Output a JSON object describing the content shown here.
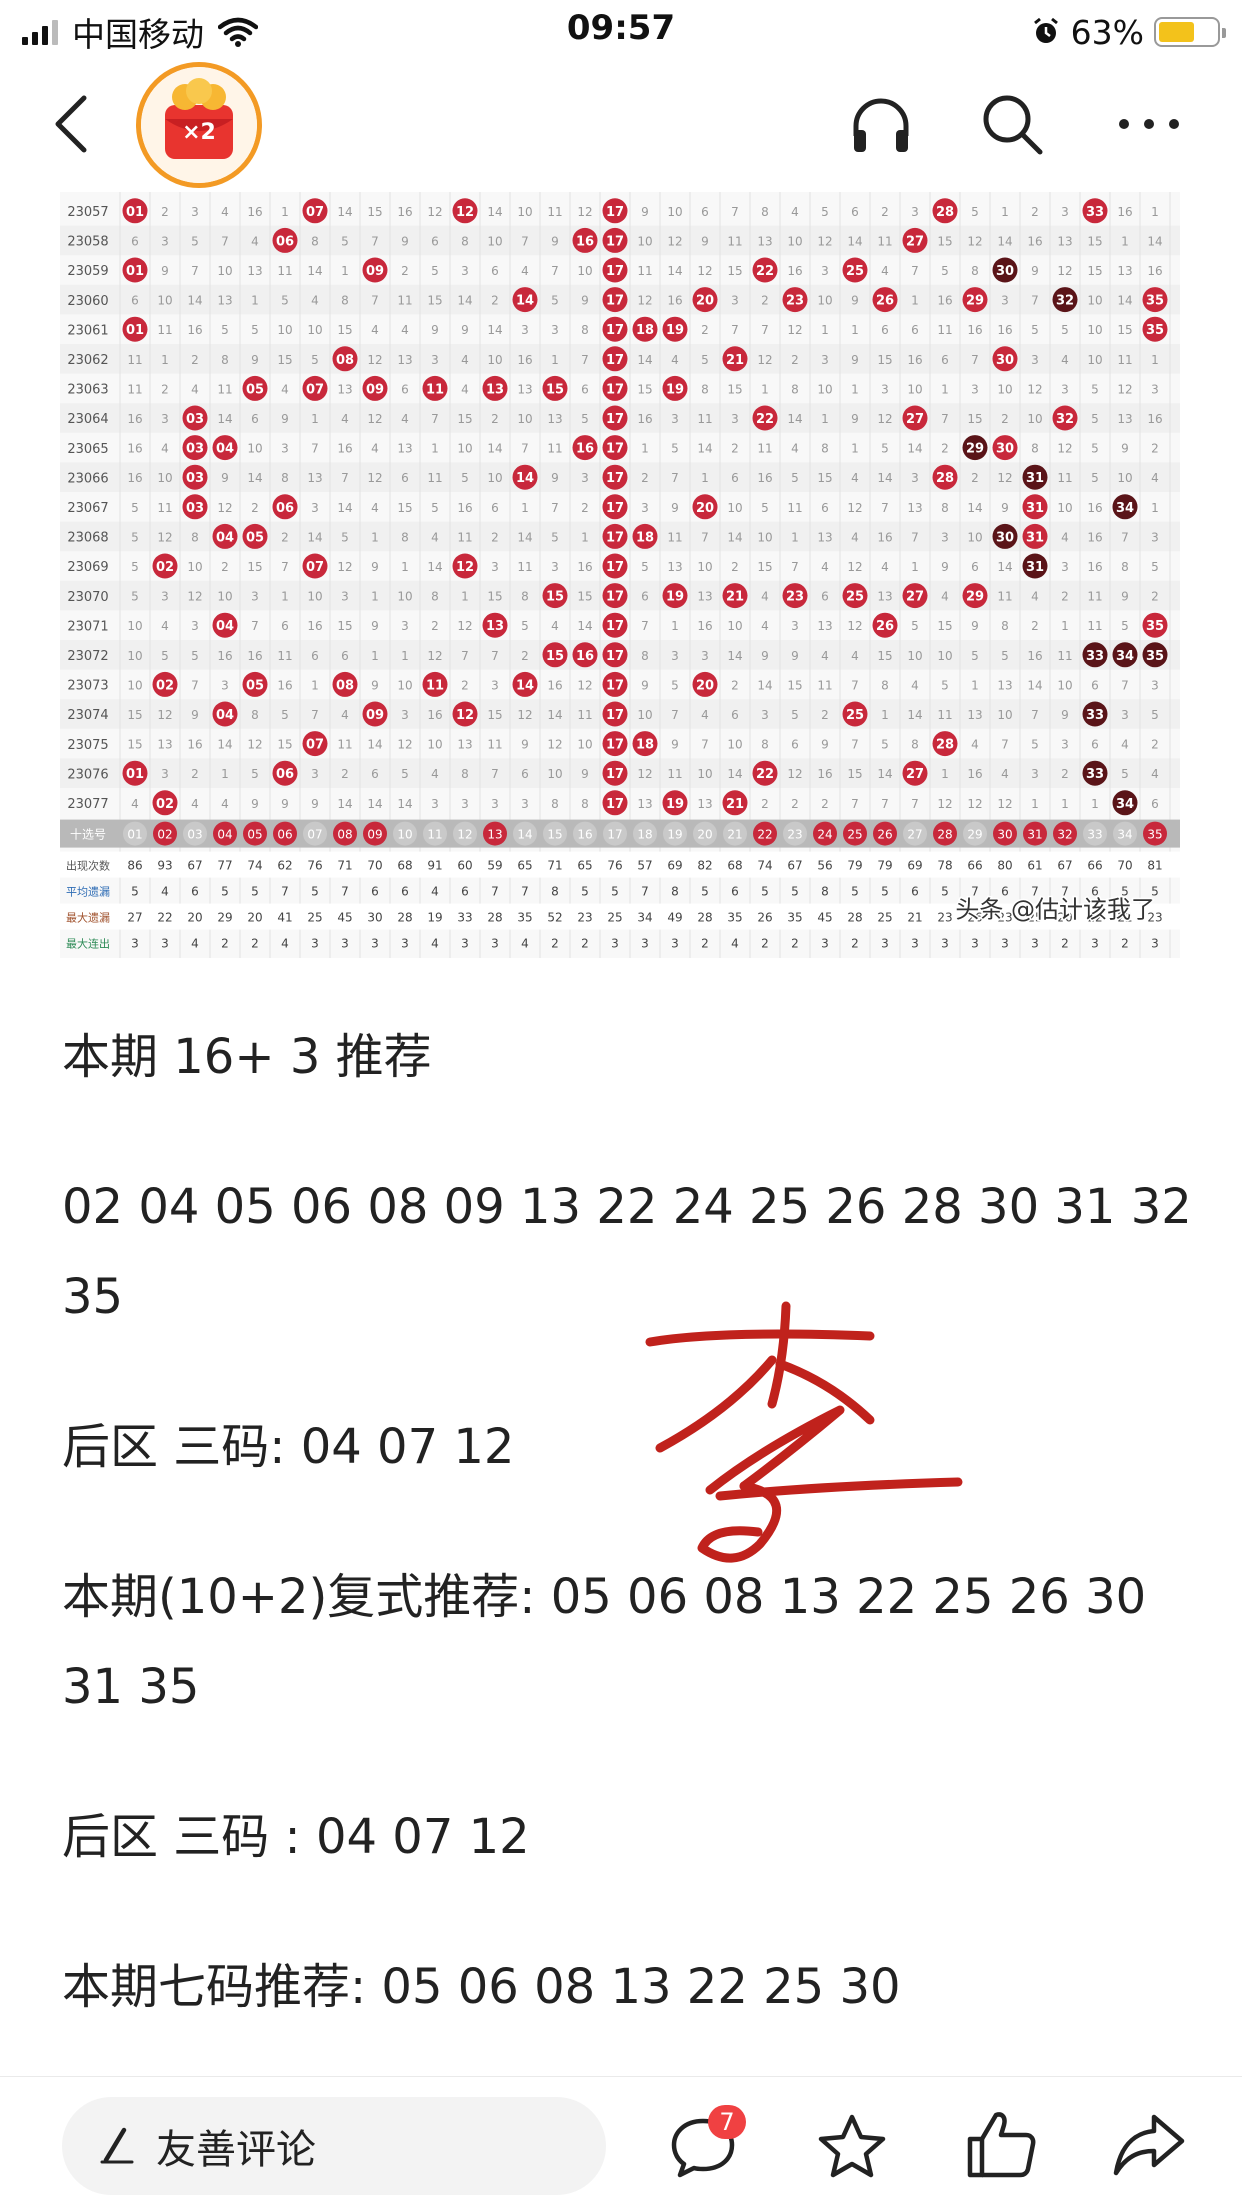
{
  "status_bar": {
    "carrier": "中国移动",
    "time": "09:57",
    "battery_percent": "63%",
    "battery_level": 0.63,
    "icons": [
      "signal-icon",
      "wifi-icon",
      "alarm-icon",
      "battery-icon"
    ]
  },
  "nav": {
    "badge_text": "×2",
    "icons": [
      "back-icon",
      "red-packet-icon",
      "headphone-icon",
      "search-icon",
      "more-icon"
    ]
  },
  "image": {
    "issues": [
      "23057",
      "23058",
      "23059",
      "23060",
      "23061",
      "23062",
      "23063",
      "23064",
      "23065",
      "23066",
      "23067",
      "23068",
      "23069",
      "23070",
      "23071",
      "23072",
      "23073",
      "23074",
      "23075",
      "23076",
      "23077"
    ],
    "selector_label": "十选号",
    "numbers": [
      "01",
      "02",
      "03",
      "04",
      "05",
      "06",
      "07",
      "08",
      "09",
      "10",
      "11",
      "12",
      "13",
      "14",
      "15",
      "16",
      "17",
      "18",
      "19",
      "20",
      "21",
      "22",
      "23",
      "24",
      "25",
      "26",
      "27",
      "28",
      "29",
      "30",
      "31",
      "32",
      "33",
      "34",
      "35"
    ],
    "stats_labels": [
      "出现次数",
      "平均遗漏",
      "最大遗漏",
      "最大连出"
    ],
    "stats_rows": [
      [
        "86",
        "93",
        "67",
        "77",
        "74",
        "62",
        "76",
        "71",
        "70",
        "68",
        "91",
        "60",
        "59",
        "65",
        "71",
        "65",
        "76",
        "57",
        "69",
        "82",
        "68",
        "74",
        "67",
        "56",
        "79",
        "79",
        "69",
        "78",
        "66",
        "80",
        "61",
        "67",
        "66",
        "70",
        "81"
      ],
      [
        "5",
        "4",
        "6",
        "5",
        "5",
        "7",
        "5",
        "7",
        "6",
        "6",
        "4",
        "6",
        "7",
        "7",
        "8",
        "5",
        "5",
        "7",
        "8",
        "5",
        "6",
        "5",
        "5",
        "8",
        "5",
        "5",
        "6",
        "5",
        "7",
        "6",
        "7",
        "7",
        "6",
        "5",
        "5"
      ],
      [
        "27",
        "22",
        "20",
        "29",
        "20",
        "41",
        "25",
        "45",
        "30",
        "28",
        "19",
        "33",
        "28",
        "35",
        "52",
        "23",
        "25",
        "34",
        "49",
        "28",
        "35",
        "26",
        "35",
        "45",
        "28",
        "25",
        "21",
        "23",
        "26",
        "23",
        "25",
        "20",
        "22",
        "22",
        "23"
      ],
      [
        "3",
        "3",
        "4",
        "2",
        "2",
        "4",
        "3",
        "3",
        "3",
        "3",
        "4",
        "3",
        "3",
        "4",
        "2",
        "2",
        "3",
        "3",
        "3",
        "2",
        "4",
        "2",
        "2",
        "3",
        "2",
        "3",
        "3",
        "3",
        "3",
        "3",
        "3",
        "2",
        "3",
        "2",
        "3"
      ]
    ],
    "watermark": "头条 @估计该我了"
  },
  "article": {
    "p1": "本期 16+ 3 推荐",
    "p2": "02 04 05 06 08 09 13 22 24 25 26 28 30 31 32 35",
    "p3": "后区 三码: 04 07 12",
    "p4": "本期(10+2)复式推荐: 05 06 08 13 22 25 26 30 31 35",
    "p5": "后区 三码 : 04 07 12",
    "p6": "本期七码推荐: 05 06 08 13 22 25 30",
    "signature_char": "李"
  },
  "bottom_bar": {
    "comment_placeholder": "友善评论",
    "comment_count": "7",
    "icons": [
      "pen-icon",
      "comment-icon",
      "star-icon",
      "like-icon",
      "share-icon"
    ]
  },
  "colors": {
    "accent_orange": "#f39a24",
    "ball_red": "#c8283b",
    "ball_dark": "#5a1418",
    "badge_red": "#f04142",
    "battery_yellow": "#f3c21b"
  }
}
